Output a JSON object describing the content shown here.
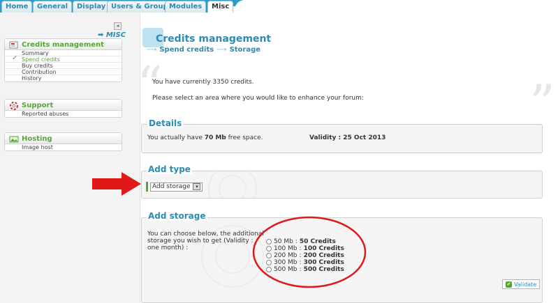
{
  "tabs": [
    {
      "label": "Home"
    },
    {
      "label": "General"
    },
    {
      "label": "Display"
    },
    {
      "label": "Users & Groups"
    },
    {
      "label": "Modules"
    },
    {
      "label": "Misc",
      "active": true
    }
  ],
  "sidebar": {
    "collapse_glyph": "◂",
    "misc_link": "➡ MISC",
    "sections": [
      {
        "title": "Credits management",
        "icon": "credits-icon",
        "items": [
          {
            "label": "Summary"
          },
          {
            "label": "Spend credits",
            "active": true
          },
          {
            "label": "Buy credits"
          },
          {
            "label": "Contribution"
          },
          {
            "label": "History"
          }
        ]
      },
      {
        "title": "Support",
        "icon": "lifebuoy-icon",
        "items": [
          {
            "label": "Reported abuses"
          }
        ]
      },
      {
        "title": "Hosting",
        "icon": "hosting-icon",
        "items": [
          {
            "label": "Image host"
          }
        ]
      }
    ]
  },
  "main": {
    "title": "Credits management",
    "breadcrumb": [
      "Spend credits",
      "Storage"
    ],
    "breadcrumb_arrow": "⟶",
    "quote_open": "“",
    "quote_close": "”",
    "intro_prefix": "You have currently ",
    "intro_credits": "3350 credits.",
    "intro_line2": "Please select an area where you would like to enhance your forum:",
    "details": {
      "legend": "Details",
      "text_prefix": "You actually have ",
      "free_space": "70 Mb",
      "text_suffix": " free space.",
      "validity": "Validity : 25 Oct 2013"
    },
    "add_type": {
      "legend": "Add type",
      "selected": "Add storage",
      "dropdown_glyph": "▾"
    },
    "add_storage": {
      "legend": "Add storage",
      "description": "You can choose below, the additional storage you wish to get (Validity : one month) :",
      "options": [
        {
          "size": "50 Mb",
          "credits": "50 Credits"
        },
        {
          "size": "100 Mb",
          "credits": "100 Credits"
        },
        {
          "size": "200 Mb",
          "credits": "200 Credits"
        },
        {
          "size": "300 Mb",
          "credits": "300 Credits"
        },
        {
          "size": "500 Mb",
          "credits": "500 Credits"
        }
      ],
      "separator": " : ",
      "validate_label": "Validate",
      "validate_glyph": "✔"
    }
  },
  "colors": {
    "accent_blue": "#2b8bb5",
    "accent_green": "#55a63a",
    "annotation_red": "#e01818",
    "tabbar_blue": "#2f9bc6"
  }
}
